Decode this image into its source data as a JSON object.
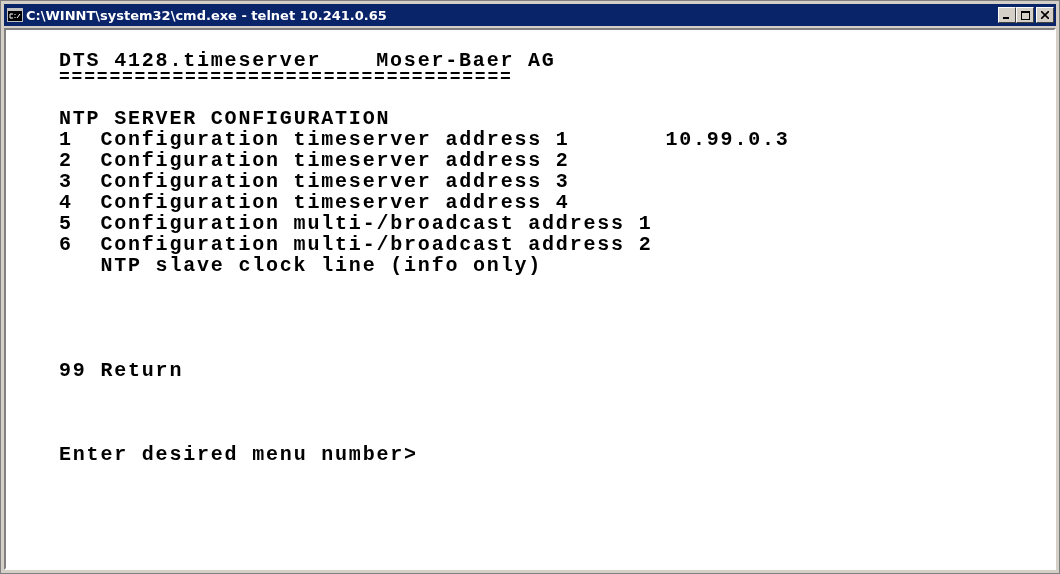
{
  "window": {
    "title": "C:\\WINNT\\system32\\cmd.exe - telnet 10.241.0.65"
  },
  "header": {
    "product": "DTS 4128.timeserver",
    "company": "Moser-Baer AG",
    "separator": "===================================="
  },
  "section_title": "NTP SERVER CONFIGURATION",
  "menu_items": [
    {
      "number": "1",
      "label": "Configuration timeserver address 1",
      "value": "10.99.0.3"
    },
    {
      "number": "2",
      "label": "Configuration timeserver address 2"
    },
    {
      "number": "3",
      "label": "Configuration timeserver address 3"
    },
    {
      "number": "4",
      "label": "Configuration timeserver address 4"
    },
    {
      "number": "5",
      "label": "Configuration multi-/broadcast address 1"
    },
    {
      "number": "6",
      "label": "Configuration multi-/broadcast address 2"
    }
  ],
  "info_line": "NTP slave clock line (info only)",
  "return_item": {
    "number": "99",
    "label": "Return"
  },
  "prompt": "Enter desired menu number>"
}
